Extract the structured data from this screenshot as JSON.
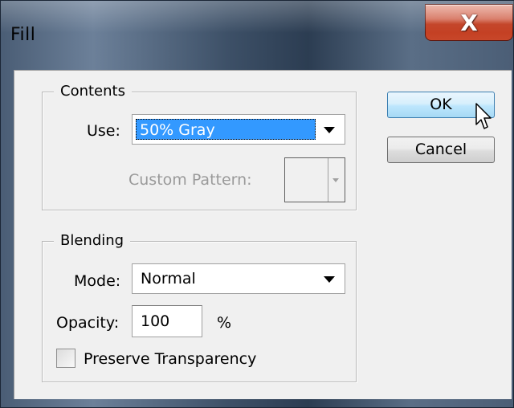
{
  "window": {
    "title": "Fill",
    "close_glyph": "X"
  },
  "contents": {
    "group_label": "Contents",
    "use_label": "Use:",
    "use_value": "50% Gray",
    "custom_pattern_label": "Custom Pattern:"
  },
  "blending": {
    "group_label": "Blending",
    "mode_label": "Mode:",
    "mode_value": "Normal",
    "opacity_label": "Opacity:",
    "opacity_value": "100",
    "opacity_unit": "%",
    "preserve_label": "Preserve Transparency"
  },
  "buttons": {
    "ok": "OK",
    "cancel": "Cancel"
  },
  "icons": [
    "close-icon",
    "dropdown-arrow-icon",
    "mouse-cursor-icon"
  ],
  "colors": {
    "selection": "#3399ff",
    "ok_border": "#3c7fb1",
    "close_red": "#c0391c"
  }
}
